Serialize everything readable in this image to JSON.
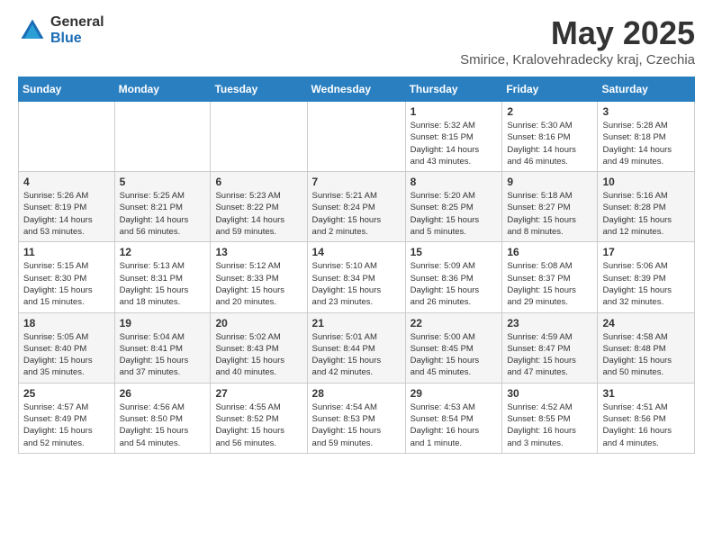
{
  "logo": {
    "general": "General",
    "blue": "Blue"
  },
  "title": {
    "month_year": "May 2025",
    "location": "Smirice, Kralovehradecky kraj, Czechia"
  },
  "calendar": {
    "headers": [
      "Sunday",
      "Monday",
      "Tuesday",
      "Wednesday",
      "Thursday",
      "Friday",
      "Saturday"
    ],
    "weeks": [
      [
        {
          "day": "",
          "info": ""
        },
        {
          "day": "",
          "info": ""
        },
        {
          "day": "",
          "info": ""
        },
        {
          "day": "",
          "info": ""
        },
        {
          "day": "1",
          "info": "Sunrise: 5:32 AM\nSunset: 8:15 PM\nDaylight: 14 hours\nand 43 minutes."
        },
        {
          "day": "2",
          "info": "Sunrise: 5:30 AM\nSunset: 8:16 PM\nDaylight: 14 hours\nand 46 minutes."
        },
        {
          "day": "3",
          "info": "Sunrise: 5:28 AM\nSunset: 8:18 PM\nDaylight: 14 hours\nand 49 minutes."
        }
      ],
      [
        {
          "day": "4",
          "info": "Sunrise: 5:26 AM\nSunset: 8:19 PM\nDaylight: 14 hours\nand 53 minutes."
        },
        {
          "day": "5",
          "info": "Sunrise: 5:25 AM\nSunset: 8:21 PM\nDaylight: 14 hours\nand 56 minutes."
        },
        {
          "day": "6",
          "info": "Sunrise: 5:23 AM\nSunset: 8:22 PM\nDaylight: 14 hours\nand 59 minutes."
        },
        {
          "day": "7",
          "info": "Sunrise: 5:21 AM\nSunset: 8:24 PM\nDaylight: 15 hours\nand 2 minutes."
        },
        {
          "day": "8",
          "info": "Sunrise: 5:20 AM\nSunset: 8:25 PM\nDaylight: 15 hours\nand 5 minutes."
        },
        {
          "day": "9",
          "info": "Sunrise: 5:18 AM\nSunset: 8:27 PM\nDaylight: 15 hours\nand 8 minutes."
        },
        {
          "day": "10",
          "info": "Sunrise: 5:16 AM\nSunset: 8:28 PM\nDaylight: 15 hours\nand 12 minutes."
        }
      ],
      [
        {
          "day": "11",
          "info": "Sunrise: 5:15 AM\nSunset: 8:30 PM\nDaylight: 15 hours\nand 15 minutes."
        },
        {
          "day": "12",
          "info": "Sunrise: 5:13 AM\nSunset: 8:31 PM\nDaylight: 15 hours\nand 18 minutes."
        },
        {
          "day": "13",
          "info": "Sunrise: 5:12 AM\nSunset: 8:33 PM\nDaylight: 15 hours\nand 20 minutes."
        },
        {
          "day": "14",
          "info": "Sunrise: 5:10 AM\nSunset: 8:34 PM\nDaylight: 15 hours\nand 23 minutes."
        },
        {
          "day": "15",
          "info": "Sunrise: 5:09 AM\nSunset: 8:36 PM\nDaylight: 15 hours\nand 26 minutes."
        },
        {
          "day": "16",
          "info": "Sunrise: 5:08 AM\nSunset: 8:37 PM\nDaylight: 15 hours\nand 29 minutes."
        },
        {
          "day": "17",
          "info": "Sunrise: 5:06 AM\nSunset: 8:39 PM\nDaylight: 15 hours\nand 32 minutes."
        }
      ],
      [
        {
          "day": "18",
          "info": "Sunrise: 5:05 AM\nSunset: 8:40 PM\nDaylight: 15 hours\nand 35 minutes."
        },
        {
          "day": "19",
          "info": "Sunrise: 5:04 AM\nSunset: 8:41 PM\nDaylight: 15 hours\nand 37 minutes."
        },
        {
          "day": "20",
          "info": "Sunrise: 5:02 AM\nSunset: 8:43 PM\nDaylight: 15 hours\nand 40 minutes."
        },
        {
          "day": "21",
          "info": "Sunrise: 5:01 AM\nSunset: 8:44 PM\nDaylight: 15 hours\nand 42 minutes."
        },
        {
          "day": "22",
          "info": "Sunrise: 5:00 AM\nSunset: 8:45 PM\nDaylight: 15 hours\nand 45 minutes."
        },
        {
          "day": "23",
          "info": "Sunrise: 4:59 AM\nSunset: 8:47 PM\nDaylight: 15 hours\nand 47 minutes."
        },
        {
          "day": "24",
          "info": "Sunrise: 4:58 AM\nSunset: 8:48 PM\nDaylight: 15 hours\nand 50 minutes."
        }
      ],
      [
        {
          "day": "25",
          "info": "Sunrise: 4:57 AM\nSunset: 8:49 PM\nDaylight: 15 hours\nand 52 minutes."
        },
        {
          "day": "26",
          "info": "Sunrise: 4:56 AM\nSunset: 8:50 PM\nDaylight: 15 hours\nand 54 minutes."
        },
        {
          "day": "27",
          "info": "Sunrise: 4:55 AM\nSunset: 8:52 PM\nDaylight: 15 hours\nand 56 minutes."
        },
        {
          "day": "28",
          "info": "Sunrise: 4:54 AM\nSunset: 8:53 PM\nDaylight: 15 hours\nand 59 minutes."
        },
        {
          "day": "29",
          "info": "Sunrise: 4:53 AM\nSunset: 8:54 PM\nDaylight: 16 hours\nand 1 minute."
        },
        {
          "day": "30",
          "info": "Sunrise: 4:52 AM\nSunset: 8:55 PM\nDaylight: 16 hours\nand 3 minutes."
        },
        {
          "day": "31",
          "info": "Sunrise: 4:51 AM\nSunset: 8:56 PM\nDaylight: 16 hours\nand 4 minutes."
        }
      ]
    ]
  }
}
